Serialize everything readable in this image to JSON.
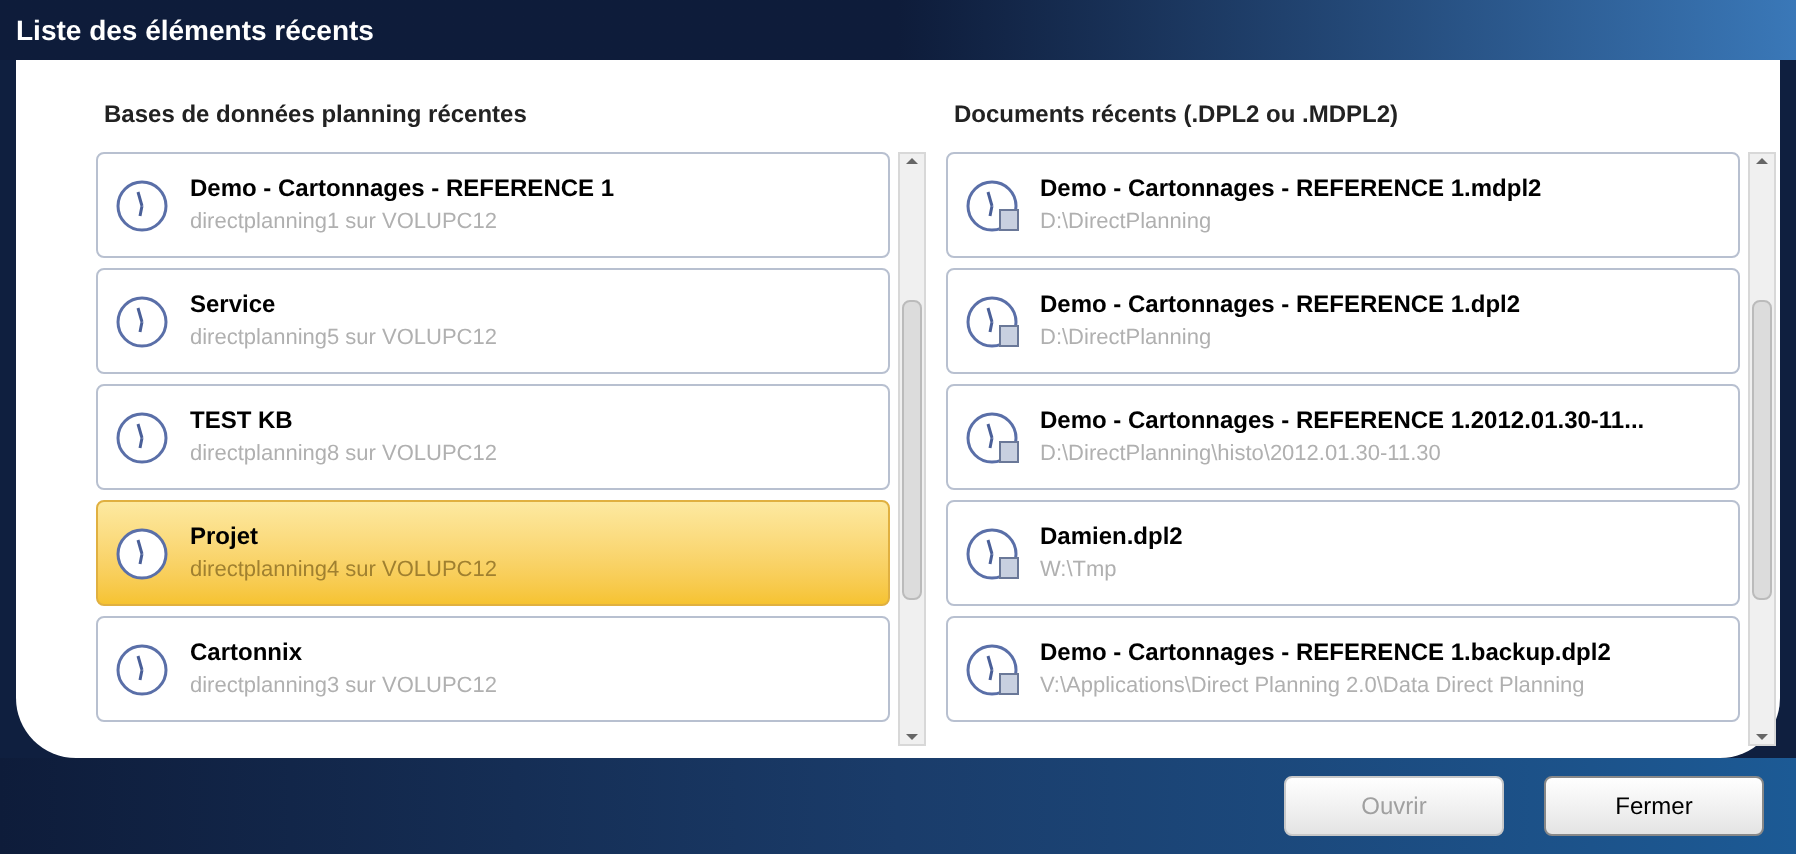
{
  "window": {
    "title": "Liste des éléments récents"
  },
  "databases": {
    "heading": "Bases de données planning récentes",
    "items": [
      {
        "title": "Demo - Cartonnages - REFERENCE 1",
        "subtitle": "directplanning1 sur  VOLUPC12",
        "selected": false
      },
      {
        "title": "Service",
        "subtitle": "directplanning5 sur  VOLUPC12",
        "selected": false
      },
      {
        "title": "TEST KB",
        "subtitle": "directplanning8 sur  VOLUPC12",
        "selected": false
      },
      {
        "title": "Projet",
        "subtitle": "directplanning4 sur  VOLUPC12",
        "selected": true
      },
      {
        "title": "Cartonnix",
        "subtitle": "directplanning3 sur  VOLUPC12",
        "selected": false
      }
    ]
  },
  "documents": {
    "heading": "Documents récents (.DPL2 ou .MDPL2)",
    "items": [
      {
        "title": "Demo - Cartonnages - REFERENCE 1.mdpl2",
        "subtitle": "D:\\DirectPlanning",
        "selected": false
      },
      {
        "title": "Demo - Cartonnages - REFERENCE 1.dpl2",
        "subtitle": "D:\\DirectPlanning",
        "selected": false
      },
      {
        "title": "Demo - Cartonnages - REFERENCE 1.2012.01.30-11...",
        "subtitle": "D:\\DirectPlanning\\histo\\2012.01.30-11.30",
        "selected": false
      },
      {
        "title": "Damien.dpl2",
        "subtitle": "W:\\Tmp",
        "selected": false
      },
      {
        "title": "Demo - Cartonnages - REFERENCE 1.backup.dpl2",
        "subtitle": "V:\\Applications\\Direct Planning 2.0\\Data Direct Planning",
        "selected": false
      }
    ]
  },
  "buttons": [
    {
      "label": "Ouvrir",
      "disabled": true
    },
    {
      "label": "Fermer",
      "disabled": false
    }
  ]
}
